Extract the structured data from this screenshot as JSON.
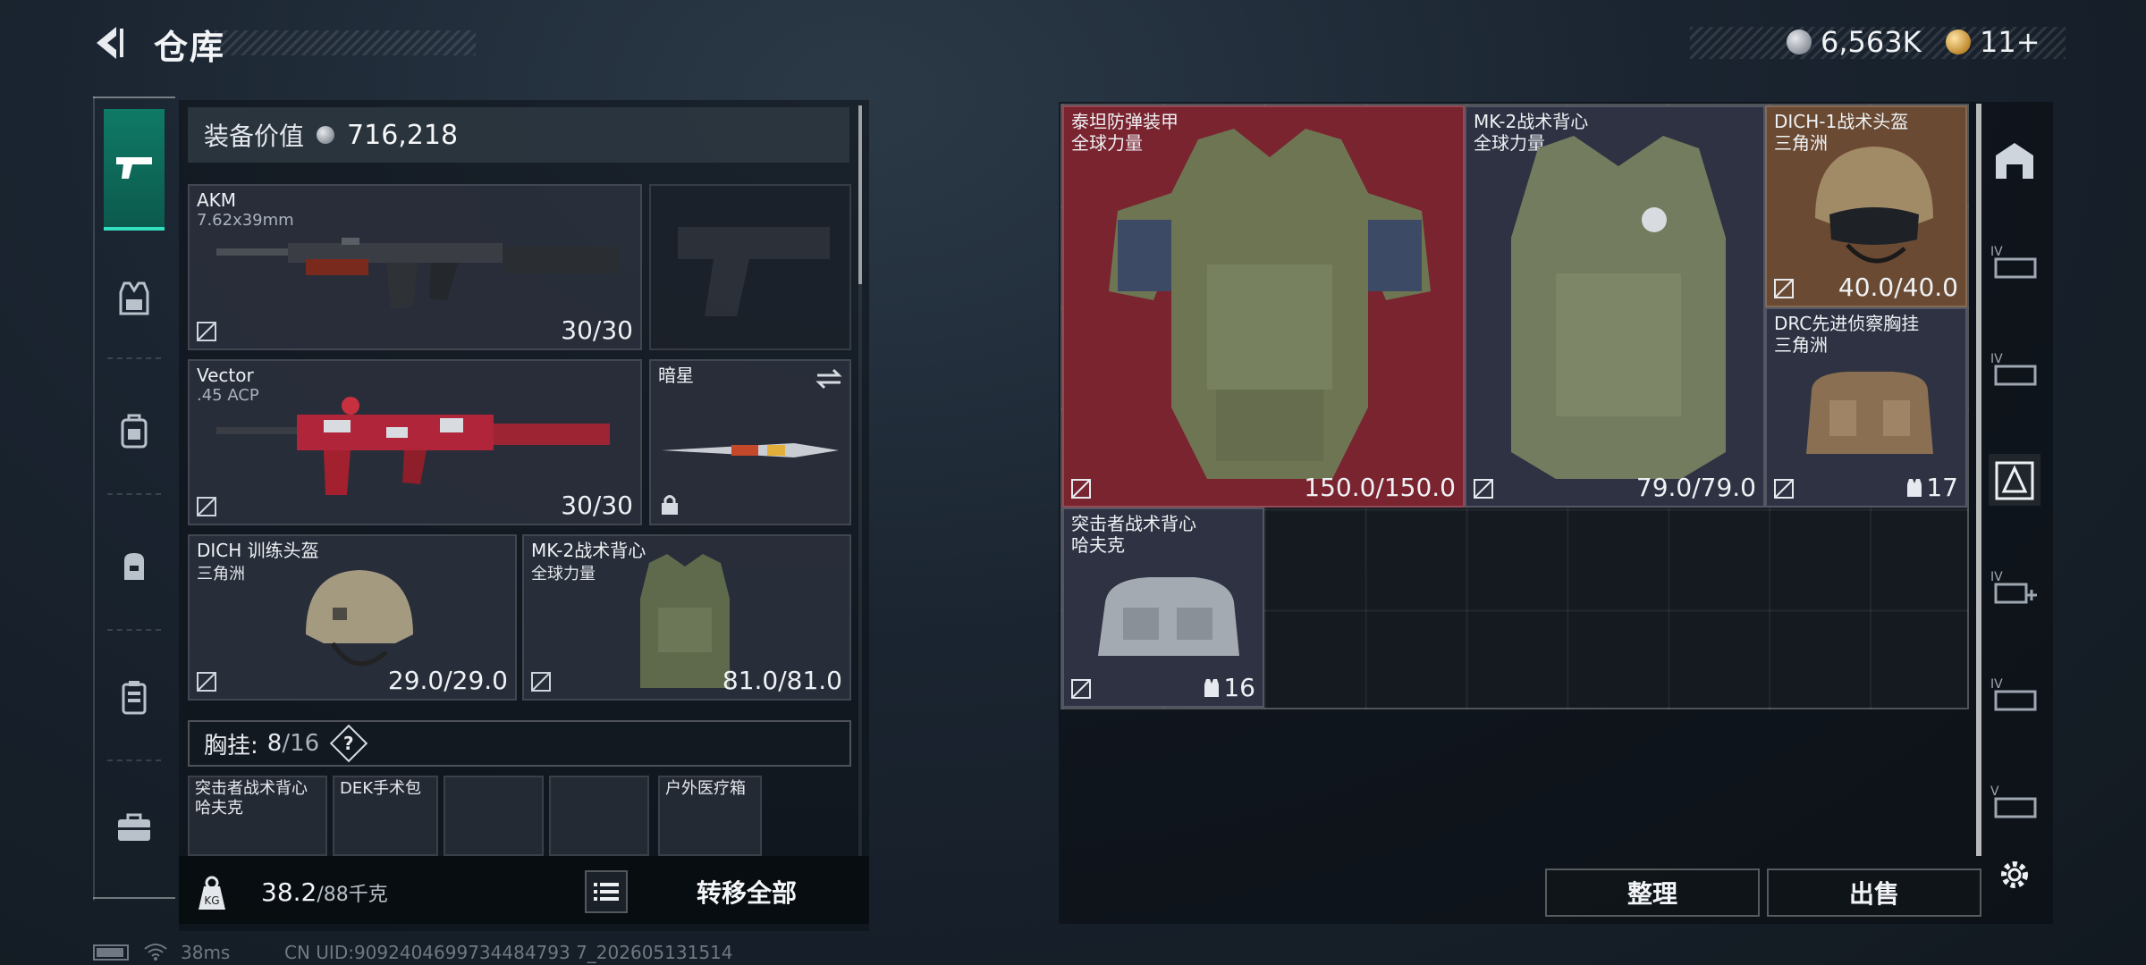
{
  "header": {
    "title": "仓库",
    "silver": "6,563K",
    "gold": "11+"
  },
  "equipment_value": {
    "label": "装备价值",
    "value": "716,218"
  },
  "weapons": [
    {
      "name": "AKM",
      "ammo": "7.62x39mm",
      "count": "30/30"
    },
    {
      "name": "Vector",
      "ammo": ".45 ACP",
      "count": "30/30"
    }
  ],
  "melee": {
    "name": "暗星"
  },
  "helmet": {
    "name": "DICH 训练头盔",
    "source": "三角洲",
    "durability": "29.0/29.0"
  },
  "armor": {
    "name": "MK-2战术背心",
    "source": "全球力量",
    "durability": "81.0/81.0"
  },
  "chest_rig": {
    "label": "胸挂:",
    "used": "8",
    "capacity": "/16",
    "help": "?"
  },
  "rig_slots": [
    {
      "name": "突击者战术背心",
      "source": "哈夫克"
    },
    {
      "name": "DEK手术包"
    },
    {
      "name": ""
    },
    {
      "name": ""
    },
    {
      "name": "户外医疗箱"
    }
  ],
  "weight": {
    "current": "38.2",
    "max": "/88千克"
  },
  "actions": {
    "transfer_all": "转移全部",
    "sort": "整理",
    "sell": "出售"
  },
  "storage": [
    {
      "name": "泰坦防弹装甲",
      "source": "全球力量",
      "value": "150.0/150.0"
    },
    {
      "name": "MK-2战术背心",
      "source": "全球力量",
      "value": "79.0/79.0"
    },
    {
      "name": "DICH-1战术头盔",
      "source": "三角洲",
      "value": "40.0/40.0"
    },
    {
      "name": "DRC先进侦察胸挂",
      "source": "三角洲",
      "value": "17"
    },
    {
      "name": "突击者战术背心",
      "source": "哈夫克",
      "value": "16"
    }
  ],
  "status": {
    "ping": "38ms",
    "uid": "CN UID:9092404699734484793 7_202605131514"
  },
  "colors": {
    "accent": "#0f7a66",
    "armor_bg": "#7a2430",
    "helmet_bg": "#6a4a32",
    "storage_bg": "#2e3242"
  }
}
